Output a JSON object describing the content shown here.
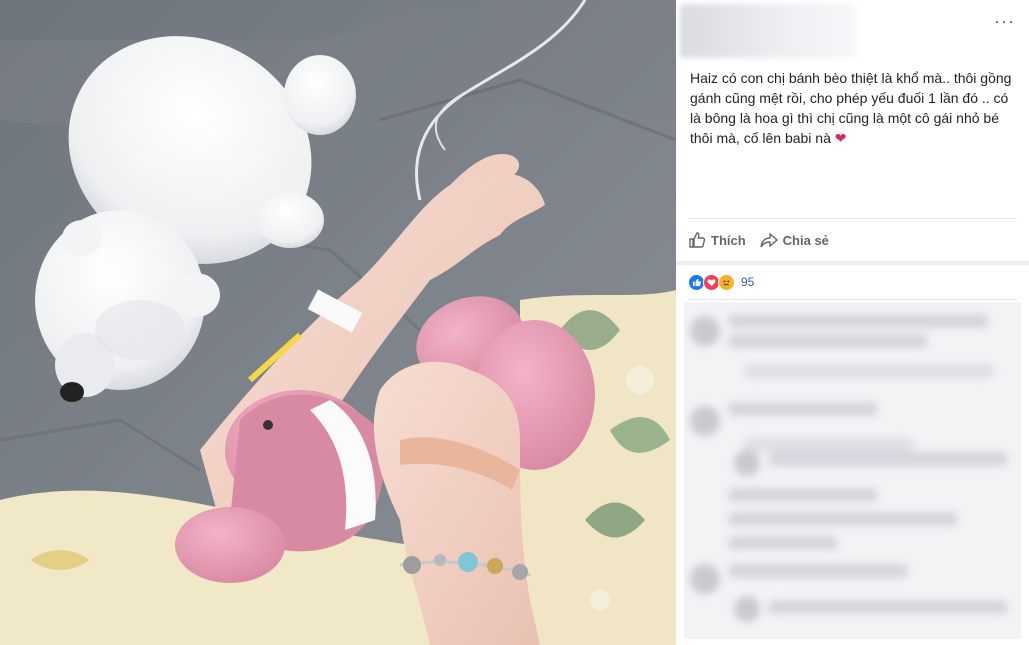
{
  "post": {
    "text": "Haiz có con chị bánh bèo thiệt là khổ mà.. thôi gồng gánh cũng mệt rồi, cho phép yếu đuối 1 lần đó .. có là bông là hoa gì thì chị cũng là một cô gái nhỏ bé thôi mà, cố lên babi nà",
    "emoji": "❤",
    "more_label": "···"
  },
  "actions": {
    "like_label": "Thích",
    "share_label": "Chia sẻ"
  },
  "reactions": {
    "count": "95",
    "icons": [
      "like-icon",
      "love-icon",
      "sad-icon"
    ]
  },
  "colors": {
    "accent": "#385898",
    "like_blue": "#1877f2",
    "love_red": "#f33e58",
    "sad_yellow": "#f7b125"
  },
  "photo": {
    "icons": [
      "polar-bear-plush",
      "pink-bunny-plush",
      "iv-tube",
      "bandage",
      "bracelet"
    ]
  }
}
